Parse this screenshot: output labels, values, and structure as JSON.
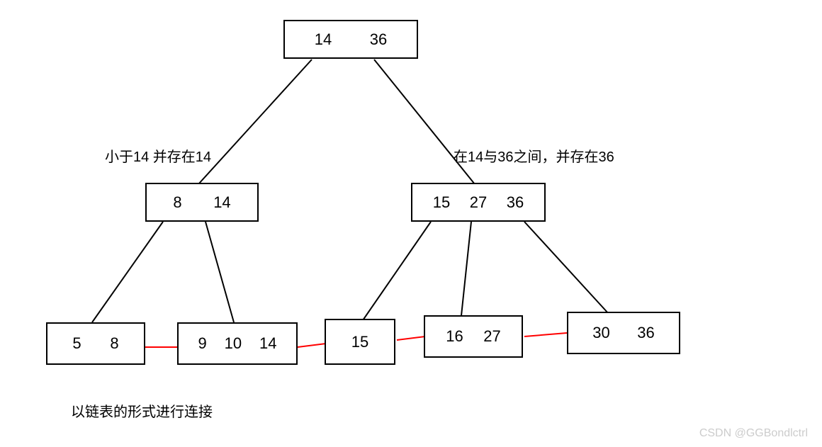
{
  "root": {
    "k1": "14",
    "k2": "36"
  },
  "left": {
    "k1": "8",
    "k2": "14"
  },
  "right": {
    "k1": "15",
    "k2": "27",
    "k3": "36"
  },
  "leaves": {
    "l1": {
      "k1": "5",
      "k2": "8"
    },
    "l2": {
      "k1": "9",
      "k2": "10",
      "k3": "14"
    },
    "l3": {
      "k1": "15"
    },
    "l4": {
      "k1": "16",
      "k2": "27"
    },
    "l5": {
      "k1": "30",
      "k2": "36"
    }
  },
  "labels": {
    "leftNote": "小于14 并存在14",
    "rightNote": "在14与36之间，并存在36",
    "bottomNote": "以链表的形式进行连接"
  },
  "watermark": "CSDN @GGBondlctrl"
}
